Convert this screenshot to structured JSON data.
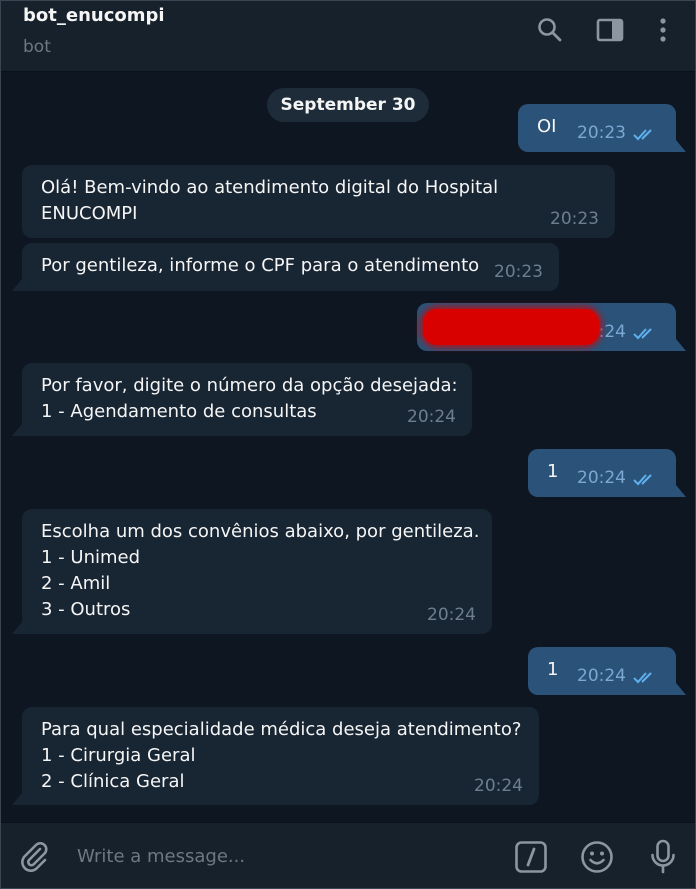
{
  "header": {
    "title": "bot_enucompi",
    "subtitle": "bot",
    "icons": [
      "search-icon",
      "sidebar-toggle-icon",
      "more-vertical-icon"
    ]
  },
  "chat": {
    "date": "September 30",
    "messages": [
      {
        "direction": "outgoing",
        "text": "OI",
        "time": "20:23",
        "status": "read"
      },
      {
        "direction": "incoming",
        "text": "Olá! Bem-vindo ao atendimento digital do Hospital\nENUCOMPI",
        "time": "20:23"
      },
      {
        "direction": "incoming",
        "text": "Por gentileza, informe o CPF para o atendimento",
        "time": "20:23"
      },
      {
        "direction": "outgoing",
        "text": "",
        "time": "20:24",
        "status": "read",
        "redacted": true
      },
      {
        "direction": "incoming",
        "text": "Por favor, digite o número da opção desejada:\n1 - Agendamento de consultas",
        "time": "20:24"
      },
      {
        "direction": "outgoing",
        "text": "1",
        "time": "20:24",
        "status": "read"
      },
      {
        "direction": "incoming",
        "text": "Escolha um dos convênios abaixo, por gentileza.\n1 - Unimed\n2 - Amil\n3 - Outros",
        "time": "20:24"
      },
      {
        "direction": "outgoing",
        "text": "1",
        "time": "20:24",
        "status": "read"
      },
      {
        "direction": "incoming",
        "text": "Para qual especialidade médica deseja atendimento?\n1 - Cirurgia Geral\n2 - Clínica Geral",
        "time": "20:24"
      }
    ]
  },
  "composer": {
    "placeholder": "Write a message...",
    "icons": [
      "attach-icon",
      "bot-commands-icon",
      "emoji-icon",
      "microphone-icon"
    ]
  },
  "colors": {
    "background": "#0e1621",
    "header": "#17212b",
    "incoming_bubble": "#182533",
    "outgoing_bubble": "#2b5278",
    "read_check": "#5fb0ef"
  }
}
